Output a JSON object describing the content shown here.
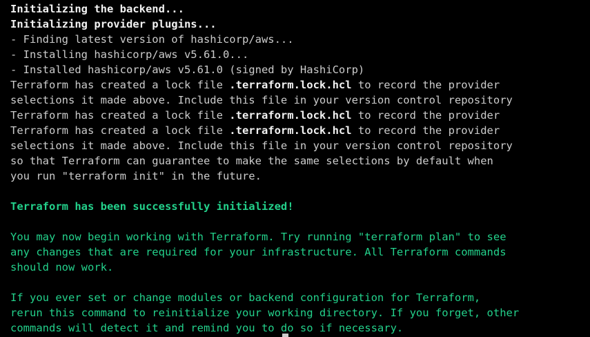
{
  "terminal": {
    "lines": [
      {
        "text": "Initializing the backend...",
        "style": "bold"
      },
      {
        "text": "Initializing provider plugins...",
        "style": "bold"
      },
      {
        "text": "- Finding latest version of hashicorp/aws...",
        "style": "normal"
      },
      {
        "text": "- Installing hashicorp/aws v5.61.0...",
        "style": "normal"
      },
      {
        "text": "- Installed hashicorp/aws v5.61.0 (signed by HashiCorp)",
        "style": "normal"
      },
      {
        "pre": "Terraform has created a lock file ",
        "bold": ".terraform.lock.hcl",
        "post": " to record the provider",
        "style": "mixed"
      },
      {
        "text": "selections it made above. Include this file in your version control repository",
        "style": "normal"
      },
      {
        "pre": "Terraform has created a lock file ",
        "bold": ".terraform.lock.hcl",
        "post": " to record the provider",
        "style": "mixed"
      },
      {
        "pre": "Terraform has created a lock file ",
        "bold": ".terraform.lock.hcl",
        "post": " to record the provider",
        "style": "mixed"
      },
      {
        "text": "selections it made above. Include this file in your version control repository",
        "style": "normal"
      },
      {
        "text": "so that Terraform can guarantee to make the same selections by default when",
        "style": "normal"
      },
      {
        "text": "you run \"terraform init\" in the future.",
        "style": "normal"
      },
      {
        "text": "",
        "style": "normal"
      },
      {
        "text": "Terraform has been successfully initialized!",
        "style": "green-bold"
      },
      {
        "text": "",
        "style": "normal"
      },
      {
        "text": "You may now begin working with Terraform. Try running \"terraform plan\" to see",
        "style": "green"
      },
      {
        "text": "any changes that are required for your infrastructure. All Terraform commands",
        "style": "green"
      },
      {
        "text": "should now work.",
        "style": "green"
      },
      {
        "text": "",
        "style": "normal"
      },
      {
        "text": "If you ever set or change modules or backend configuration for Terraform,",
        "style": "green"
      },
      {
        "text": "rerun this command to reinitialize your working directory. If you forget, other",
        "style": "green"
      },
      {
        "text": "commands will detect it and remind you to do so if necessary.",
        "style": "green"
      }
    ]
  },
  "colors": {
    "background": "#000000",
    "text": "#cccccc",
    "bold_text": "#f2f2f2",
    "success_green": "#23d18b"
  }
}
